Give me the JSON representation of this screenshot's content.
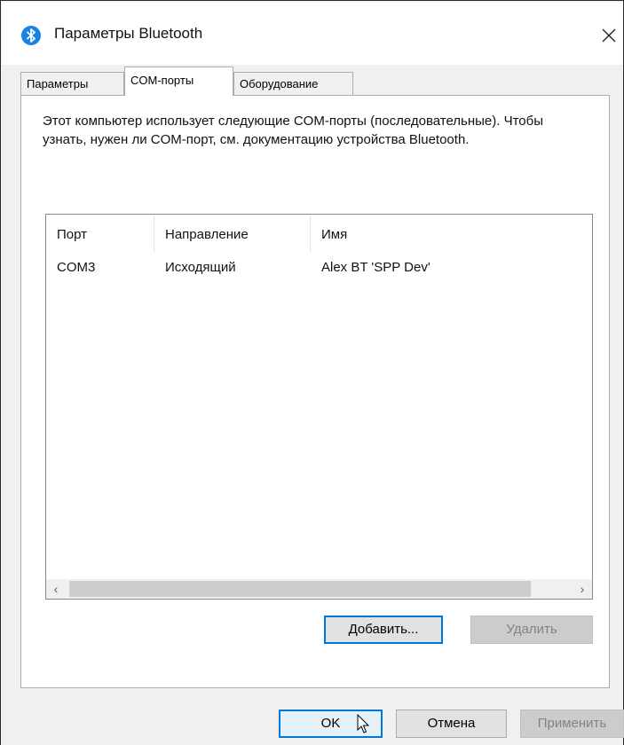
{
  "window": {
    "title": "Параметры Bluetooth",
    "icon": "bluetooth-icon",
    "close_icon": "close-icon"
  },
  "tabs": [
    {
      "label": "Параметры",
      "active": false
    },
    {
      "label": "COM-порты",
      "active": true
    },
    {
      "label": "Оборудование",
      "active": false
    }
  ],
  "panel": {
    "description": "Этот компьютер использует следующие COM-порты (последовательные). Чтобы узнать, нужен ли COM-порт, см. документацию устройства Bluetooth."
  },
  "list": {
    "columns": [
      "Порт",
      "Направление",
      "Имя"
    ],
    "rows": [
      {
        "port": "COM3",
        "direction": "Исходящий",
        "name": "Alex BT 'SPP Dev'"
      }
    ],
    "scroll_left": "‹",
    "scroll_right": "›"
  },
  "buttons": {
    "add": "Добавить...",
    "remove": "Удалить",
    "ok": "OK",
    "cancel": "Отмена",
    "apply": "Применить"
  },
  "colors": {
    "accent": "#0078d7",
    "bluetooth": "#1a82e2"
  }
}
